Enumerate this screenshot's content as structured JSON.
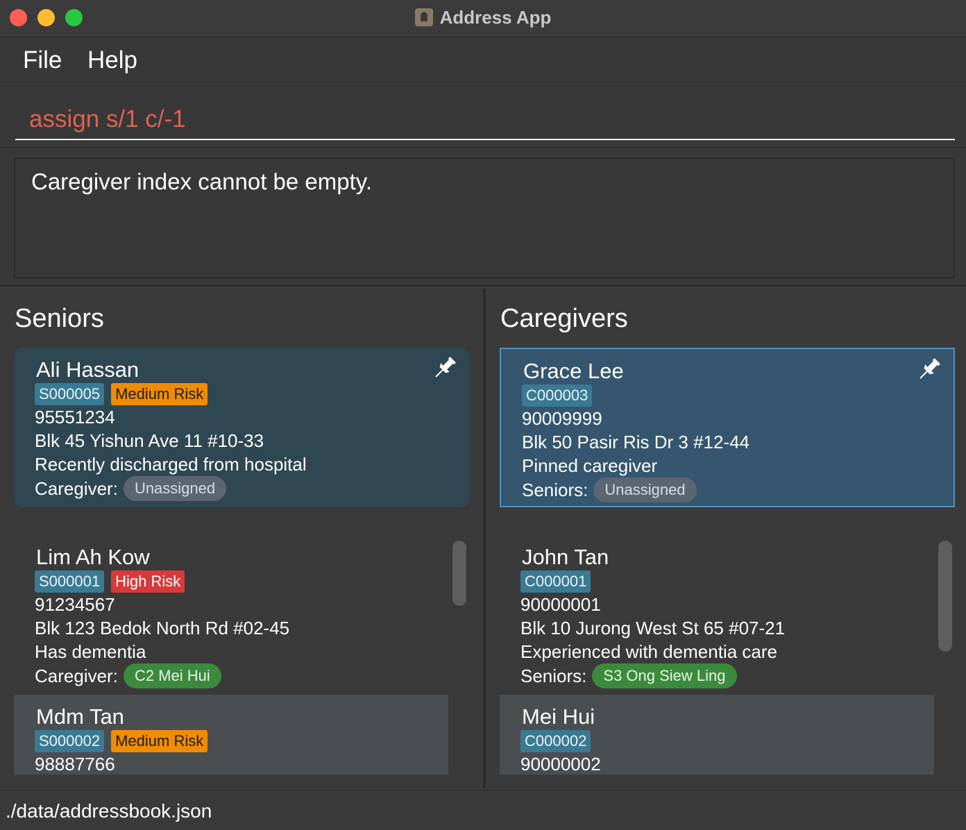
{
  "window": {
    "title": "Address App"
  },
  "menu": {
    "file": "File",
    "help": "Help"
  },
  "command": {
    "value": "assign s/1 c/-1"
  },
  "result": {
    "message": "Caregiver index cannot be empty."
  },
  "colors": {
    "error_text": "#e0614f",
    "id_tag": "#3a7a93",
    "medium_risk": "#f08c00",
    "high_risk": "#d83a3a",
    "assigned_pill": "#3c8a3c",
    "unassigned_pill": "#5a6672",
    "pinned_caregiver": "#35566e",
    "pinned_senior": "#2f4752"
  },
  "seniors": {
    "title": "Seniors",
    "pinned": {
      "name": "Ali Hassan",
      "id": "S000005",
      "risk": "Medium Risk",
      "phone": "95551234",
      "address": "Blk 45 Yishun Ave 11 #10-33",
      "note": "Recently discharged from hospital",
      "relation_label": "Caregiver:",
      "relation": "Unassigned",
      "pin_icon": "pin-icon"
    },
    "list": [
      {
        "name": "Lim Ah Kow",
        "id": "S000001",
        "risk": "High Risk",
        "phone": "91234567",
        "address": "Blk 123 Bedok North Rd #02-45",
        "note": "Has dementia",
        "relation_label": "Caregiver:",
        "relation": "C2 Mei Hui"
      },
      {
        "name": "Mdm Tan",
        "id": "S000002",
        "risk": "Medium Risk",
        "phone": "98887766"
      }
    ]
  },
  "caregivers": {
    "title": "Caregivers",
    "pinned": {
      "name": "Grace Lee",
      "id": "C000003",
      "phone": "90009999",
      "address": "Blk 50 Pasir Ris Dr 3 #12-44",
      "note": "Pinned caregiver",
      "relation_label": "Seniors:",
      "relation": "Unassigned",
      "pin_icon": "pin-icon"
    },
    "list": [
      {
        "name": "John Tan",
        "id": "C000001",
        "phone": "90000001",
        "address": "Blk 10 Jurong West St 65 #07-21",
        "note": "Experienced with dementia care",
        "relation_label": "Seniors:",
        "relation": "S3 Ong Siew Ling"
      },
      {
        "name": "Mei Hui",
        "id": "C000002",
        "phone": "90000002"
      }
    ]
  },
  "status": {
    "path": "./data/addressbook.json"
  }
}
